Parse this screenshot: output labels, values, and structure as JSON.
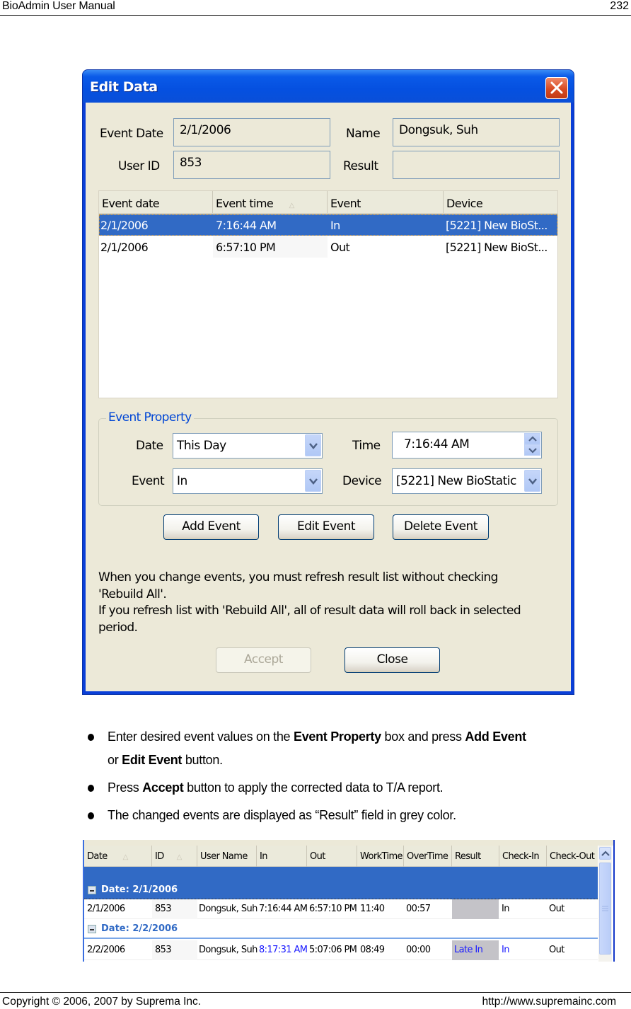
{
  "page": {
    "header_left": "BioAdmin  User  Manual",
    "page_number": "232",
    "footer_left": "Copyright © 2006, 2007 by Suprema Inc.",
    "footer_right": "http://www.supremainc.com"
  },
  "dialog": {
    "title": "Edit Data",
    "fields": {
      "event_date_label": "Event Date",
      "event_date_value": "2/1/2006",
      "user_id_label": "User ID",
      "user_id_value": "853",
      "name_label": "Name",
      "name_value": "Dongsuk, Suh",
      "result_label": "Result",
      "result_value": ""
    },
    "list": {
      "columns": [
        "Event date",
        "Event time",
        "Event",
        "Device"
      ],
      "sorted_column": "Event time",
      "rows": [
        {
          "date": "2/1/2006",
          "time": "7:16:44 AM",
          "event": "In",
          "device": "[5221] New BioSt...",
          "selected": true
        },
        {
          "date": "2/1/2006",
          "time": "6:57:10 PM",
          "event": "Out",
          "device": "[5221] New BioSt...",
          "selected": false
        }
      ]
    },
    "event_property": {
      "legend": "Event Property",
      "date_label": "Date",
      "date_value": "This Day",
      "time_label": "Time",
      "time_value": "7:16:44 AM",
      "event_label": "Event",
      "event_value": "In",
      "device_label": "Device",
      "device_value": "[5221] New BioStatic"
    },
    "buttons": {
      "add_event": "Add Event",
      "edit_event": "Edit Event",
      "delete_event": "Delete Event",
      "accept": "Accept",
      "close": "Close"
    },
    "note_lines": [
      "When you change events, you must refresh result list without checking",
      "'Rebuild All'.",
      "If you refresh list with 'Rebuild All', all of result data will roll back in selected",
      "period."
    ]
  },
  "bullets": [
    {
      "parts": [
        {
          "t": "Enter desired event values on the ",
          "b": false
        },
        {
          "t": "Event Property",
          "b": true
        },
        {
          "t": " box and press ",
          "b": false
        },
        {
          "t": "Add Event",
          "b": true
        },
        {
          "t": " or ",
          "b": false
        },
        {
          "t": "Edit Event",
          "b": true
        },
        {
          "t": " button.",
          "b": false
        }
      ]
    },
    {
      "parts": [
        {
          "t": "Press ",
          "b": false
        },
        {
          "t": "Accept",
          "b": true
        },
        {
          "t": " button to apply the corrected data to T/A report.",
          "b": false
        }
      ]
    },
    {
      "parts": [
        {
          "t": "The changed events are displayed as “Result” field in grey color.",
          "b": false
        }
      ]
    }
  ],
  "result_grid": {
    "columns": [
      "Date",
      "ID",
      "User Name",
      "In",
      "Out",
      "WorkTime",
      "OverTime",
      "Result",
      "Check-In",
      "Check-Out"
    ],
    "groups": [
      {
        "label": "Date: 2/1/2006",
        "selected": true,
        "rows": [
          {
            "date": "2/1/2006",
            "id": "853",
            "user_name": "Dongsuk, Suh",
            "in": "7:16:44 AM",
            "out": "6:57:10 PM",
            "worktime": "11:40",
            "overtime": "00:57",
            "result": "",
            "check_in": "In",
            "check_out": "Out"
          }
        ]
      },
      {
        "label": "Date: 2/2/2006",
        "selected": false,
        "rows": [
          {
            "date": "2/2/2006",
            "id": "853",
            "user_name": "Dongsuk, Suh",
            "in": "8:17:31 AM",
            "out": "5:07:06 PM",
            "worktime": "08:49",
            "overtime": "00:00",
            "result": "Late In",
            "check_in": "In",
            "check_out": "Out"
          }
        ]
      }
    ],
    "highlight_color": "#1a1aff",
    "result_grey": "#c4c3c8"
  }
}
